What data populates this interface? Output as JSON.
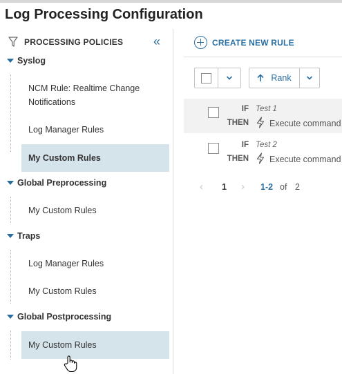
{
  "page": {
    "title": "Log Processing Configuration"
  },
  "sidebar": {
    "header": "PROCESSING POLICIES",
    "groups": [
      {
        "label": "Syslog",
        "items": [
          "NCM Rule: Realtime Change",
          "Notifications",
          "Log Manager Rules",
          "My Custom Rules"
        ]
      },
      {
        "label": "Global Preprocessing",
        "items": [
          "My Custom Rules"
        ]
      },
      {
        "label": "Traps",
        "items": [
          "Log Manager Rules",
          "My Custom Rules"
        ]
      },
      {
        "label": "Global Postprocessing",
        "items": [
          "My Custom Rules"
        ]
      }
    ]
  },
  "toolbar": {
    "create_label": "CREATE NEW RULE",
    "rank_label": "Rank"
  },
  "rules": [
    {
      "if_kw": "IF",
      "then_kw": "THEN",
      "name": "Test 1",
      "action": "Execute command"
    },
    {
      "if_kw": "IF",
      "then_kw": "THEN",
      "name": "Test 2",
      "action": "Execute command"
    }
  ],
  "pagination": {
    "current": "1",
    "range": "1-2",
    "of_label": "of",
    "total": "2"
  },
  "colors": {
    "accent": "#2a6ea0",
    "selected_bg": "#d5e3ea"
  }
}
